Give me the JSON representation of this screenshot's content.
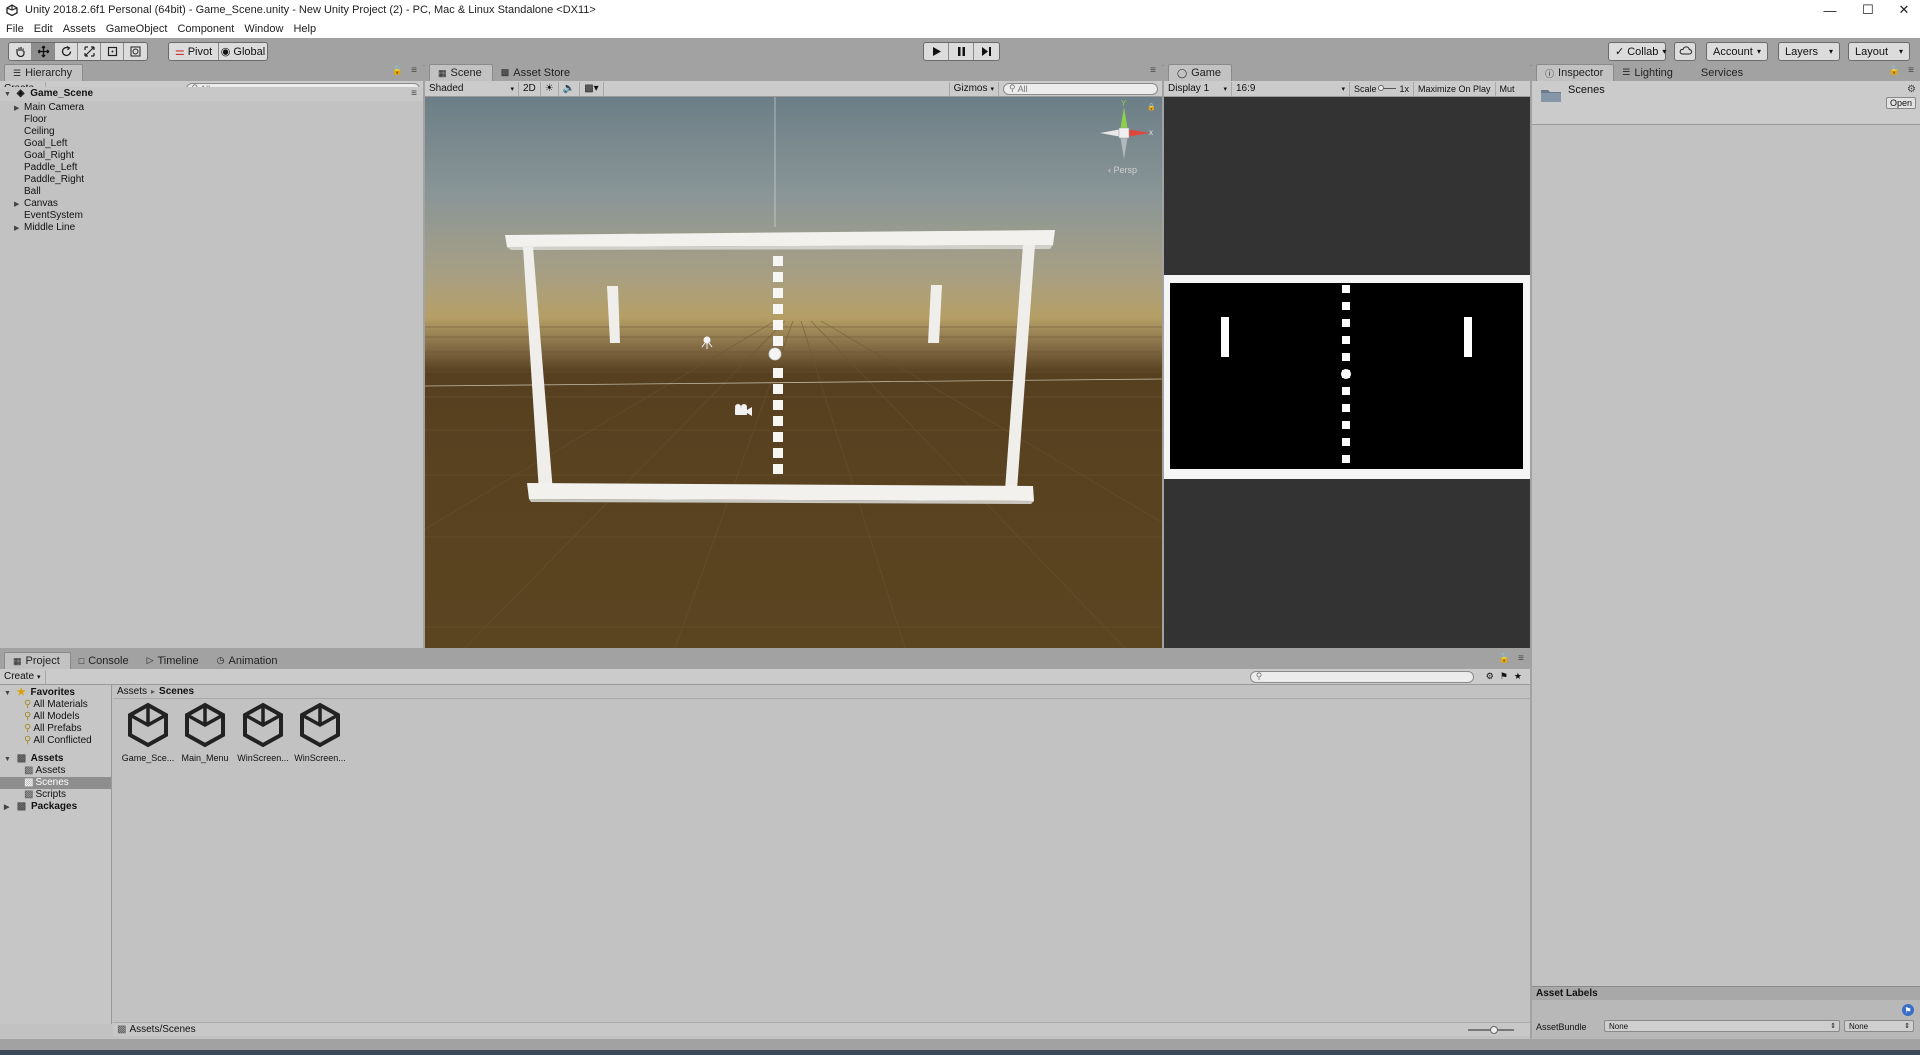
{
  "window": {
    "title": "Unity 2018.2.6f1 Personal (64bit) - Game_Scene.unity - New Unity Project (2) - PC, Mac & Linux Standalone <DX11>",
    "minimize": "—",
    "maximize": "☐",
    "close": "✕"
  },
  "menu": [
    "File",
    "Edit",
    "Assets",
    "GameObject",
    "Component",
    "Window",
    "Help"
  ],
  "toolbar": {
    "pivot": "Pivot",
    "global": "Global",
    "collab": "Collab",
    "account": "Account",
    "layers": "Layers",
    "layout": "Layout"
  },
  "hierarchy": {
    "tab": "Hierarchy",
    "create": "Create",
    "search_placeholder": "All",
    "scene": "Game_Scene",
    "items": [
      {
        "label": "Main Camera",
        "expandable": true
      },
      {
        "label": "Floor",
        "expandable": false
      },
      {
        "label": "Ceiling",
        "expandable": false
      },
      {
        "label": "Goal_Left",
        "expandable": false
      },
      {
        "label": "Goal_Right",
        "expandable": false
      },
      {
        "label": "Paddle_Left",
        "expandable": false
      },
      {
        "label": "Paddle_Right",
        "expandable": false
      },
      {
        "label": "Ball",
        "expandable": false
      },
      {
        "label": "Canvas",
        "expandable": true
      },
      {
        "label": "EventSystem",
        "expandable": false
      },
      {
        "label": "Middle Line",
        "expandable": true
      }
    ]
  },
  "scene": {
    "tabs": [
      "Scene",
      "Asset Store"
    ],
    "shading": "Shaded",
    "mode_2d": "2D",
    "gizmos": "Gizmos",
    "search_placeholder": "All",
    "persp": "‹ Persp",
    "axis_y": "Y",
    "axis_x": "x"
  },
  "game": {
    "tab": "Game",
    "display": "Display 1",
    "aspect": "16:9",
    "scale_label": "Scale",
    "scale_value": "1x",
    "maximize": "Maximize On Play",
    "mute": "Mut"
  },
  "inspector": {
    "tabs": [
      "Inspector",
      "Lighting",
      "Services"
    ],
    "folder_name": "Scenes",
    "open_button": "Open",
    "asset_labels": "Asset Labels",
    "asset_bundle_label": "AssetBundle",
    "asset_bundle_value": "None",
    "asset_bundle_variant": "None"
  },
  "project": {
    "tabs": [
      "Project",
      "Console",
      "Timeline",
      "Animation"
    ],
    "create": "Create",
    "breadcrumb_root": "Assets",
    "breadcrumb_sep": "▸",
    "breadcrumb_current": "Scenes",
    "favorites_label": "Favorites",
    "favorites": [
      "All Materials",
      "All Models",
      "All Prefabs",
      "All Conflicted"
    ],
    "assets_label": "Assets",
    "asset_folders": [
      "Assets",
      "Scenes",
      "Scripts"
    ],
    "packages_label": "Packages",
    "files": [
      "Game_Sce...",
      "Main_Menu",
      "WinScreen...",
      "WinScreen..."
    ],
    "path": "Assets/Scenes"
  },
  "colors": {
    "editor_bg": "#a2a2a2",
    "panel_bg": "#c2c2c2",
    "selection": "#8e8e8e",
    "game_bg": "#333333",
    "game_black": "#000000",
    "axis_x": "#e0473c",
    "axis_y": "#8bd14b"
  }
}
